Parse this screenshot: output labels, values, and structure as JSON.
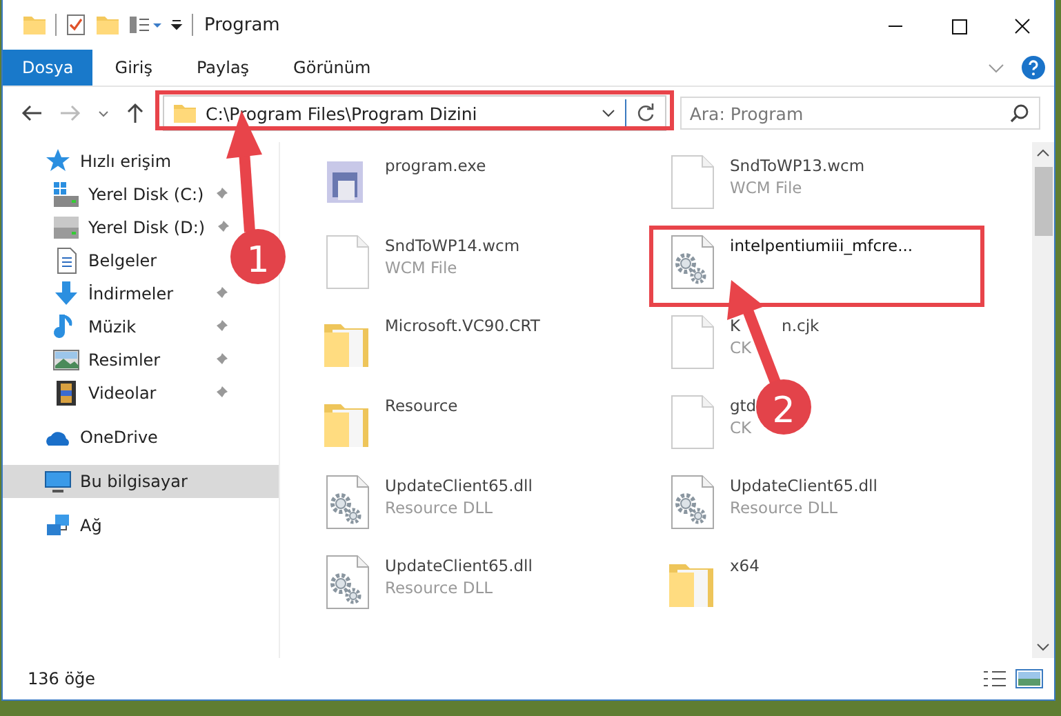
{
  "window": {
    "title": "Program"
  },
  "ribbon_tabs": [
    {
      "label": "Dosya",
      "selected": true
    },
    {
      "label": "Giriş",
      "selected": false
    },
    {
      "label": "Paylaş",
      "selected": false
    },
    {
      "label": "Görünüm",
      "selected": false
    }
  ],
  "address": {
    "value": "C:\\Program Files\\Program Dizini"
  },
  "search": {
    "placeholder": "Ara: Program"
  },
  "sidebar": {
    "items": [
      {
        "label": "Hızlı erişim",
        "kind": "star",
        "selected": false,
        "children": [
          {
            "label": "Yerel Disk (C:)",
            "kind": "drive-win",
            "pinned": true,
            "selected": false
          },
          {
            "label": "Yerel Disk (D:)",
            "kind": "drive",
            "pinned": true,
            "selected": false
          },
          {
            "label": "Belgeler",
            "kind": "doc",
            "pinned": false,
            "selected": false
          },
          {
            "label": "İndirmeler",
            "kind": "download",
            "pinned": true,
            "selected": false
          },
          {
            "label": "Müzik",
            "kind": "music",
            "pinned": true,
            "selected": false
          },
          {
            "label": "Resimler",
            "kind": "image",
            "pinned": true,
            "selected": false
          },
          {
            "label": "Videolar",
            "kind": "video",
            "pinned": true,
            "selected": false
          }
        ]
      },
      {
        "label": "OneDrive",
        "kind": "cloud",
        "selected": false
      },
      {
        "label": "Bu bilgisayar",
        "kind": "pc",
        "selected": true
      },
      {
        "label": "Ağ",
        "kind": "network",
        "selected": false
      }
    ]
  },
  "files": [
    {
      "name": "program.exe",
      "kind": "exe",
      "highlighted": false
    },
    {
      "name": "SndToWP13.wcm",
      "type": "WCM File",
      "kind": "blank",
      "highlighted": false
    },
    {
      "name": "SndToWP14.wcm",
      "type": "WCM File",
      "kind": "blank",
      "highlighted": false
    },
    {
      "name": "intelpentiumiii_mfcre...",
      "kind": "gear",
      "highlighted": true
    },
    {
      "name": "Microsoft.VC90.CRT",
      "kind": "folder",
      "highlighted": false
    },
    {
      "name": "K",
      "name_end": "n.cjk",
      "type": "CK",
      "kind": "blank",
      "highlighted": false
    },
    {
      "name": "Resource",
      "kind": "folder",
      "highlighted": false
    },
    {
      "name": "gtd",
      "type": "CK",
      "kind": "blank",
      "highlighted": false
    },
    {
      "name": "UpdateClient65.dll",
      "type": "Resource DLL",
      "kind": "gear",
      "highlighted": false
    },
    {
      "name": "UpdateClient65.dll",
      "type": "Resource DLL",
      "kind": "gear",
      "highlighted": false
    },
    {
      "name": "UpdateClient65.dll",
      "type": "Resource DLL",
      "kind": "gear",
      "highlighted": false
    },
    {
      "name": "x64",
      "kind": "folder",
      "highlighted": false
    }
  ],
  "status_bar": {
    "count": "136 öğe"
  },
  "annotations": [
    {
      "number": "1"
    },
    {
      "number": "2"
    }
  ]
}
